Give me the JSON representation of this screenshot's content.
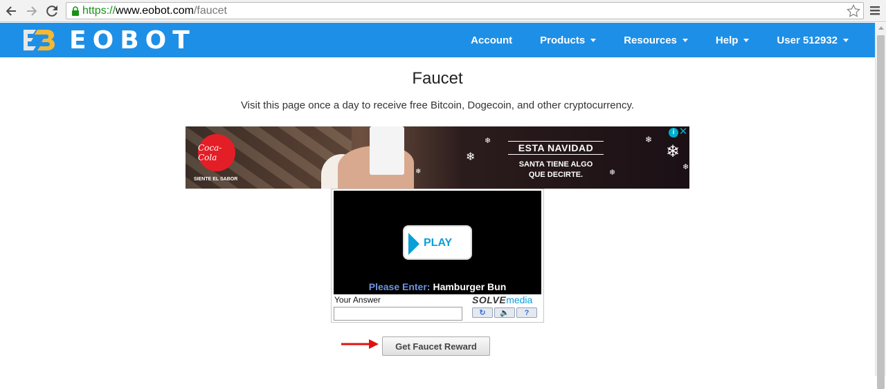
{
  "browser": {
    "url_scheme": "https://",
    "url_host": "www.eobot.com",
    "url_path": "/faucet",
    "icons": [
      "back-icon",
      "forward-icon",
      "reload-icon",
      "lock-icon",
      "star-icon",
      "menu-icon"
    ]
  },
  "site": {
    "brand": "EOBOT",
    "nav": [
      {
        "label": "Account",
        "dropdown": false
      },
      {
        "label": "Products",
        "dropdown": true
      },
      {
        "label": "Resources",
        "dropdown": true
      },
      {
        "label": "Help",
        "dropdown": true
      },
      {
        "label": "User 512932",
        "dropdown": true
      }
    ],
    "colors": {
      "nav_bg": "#1e8fe6",
      "link_accent": "#0a9fd8"
    }
  },
  "page": {
    "title": "Faucet",
    "description": "Visit this page once a day to receive free Bitcoin, Dogecoin, and other cryptocurrency."
  },
  "ad": {
    "brand": "Coca-Cola",
    "tagline": "SIENTE EL SABOR",
    "headline": "ESTA NAVIDAD",
    "subline1": "SANTA TIENE ALGO",
    "subline2": "QUE DECIRTE.",
    "info_glyph": "i",
    "close_glyph": "✕"
  },
  "captcha": {
    "play_label": "PLAY",
    "prompt_label": "Please Enter:",
    "prompt_value": "Hamburger Bun",
    "answer_label": "Your Answer",
    "answer_value": "",
    "logo_part1": "SOLVE",
    "logo_part2": "media",
    "buttons": [
      {
        "name": "reload",
        "glyph": "↻"
      },
      {
        "name": "audio",
        "glyph": "🔈"
      },
      {
        "name": "help",
        "glyph": "?"
      }
    ]
  },
  "reward": {
    "button_label": "Get Faucet Reward"
  }
}
